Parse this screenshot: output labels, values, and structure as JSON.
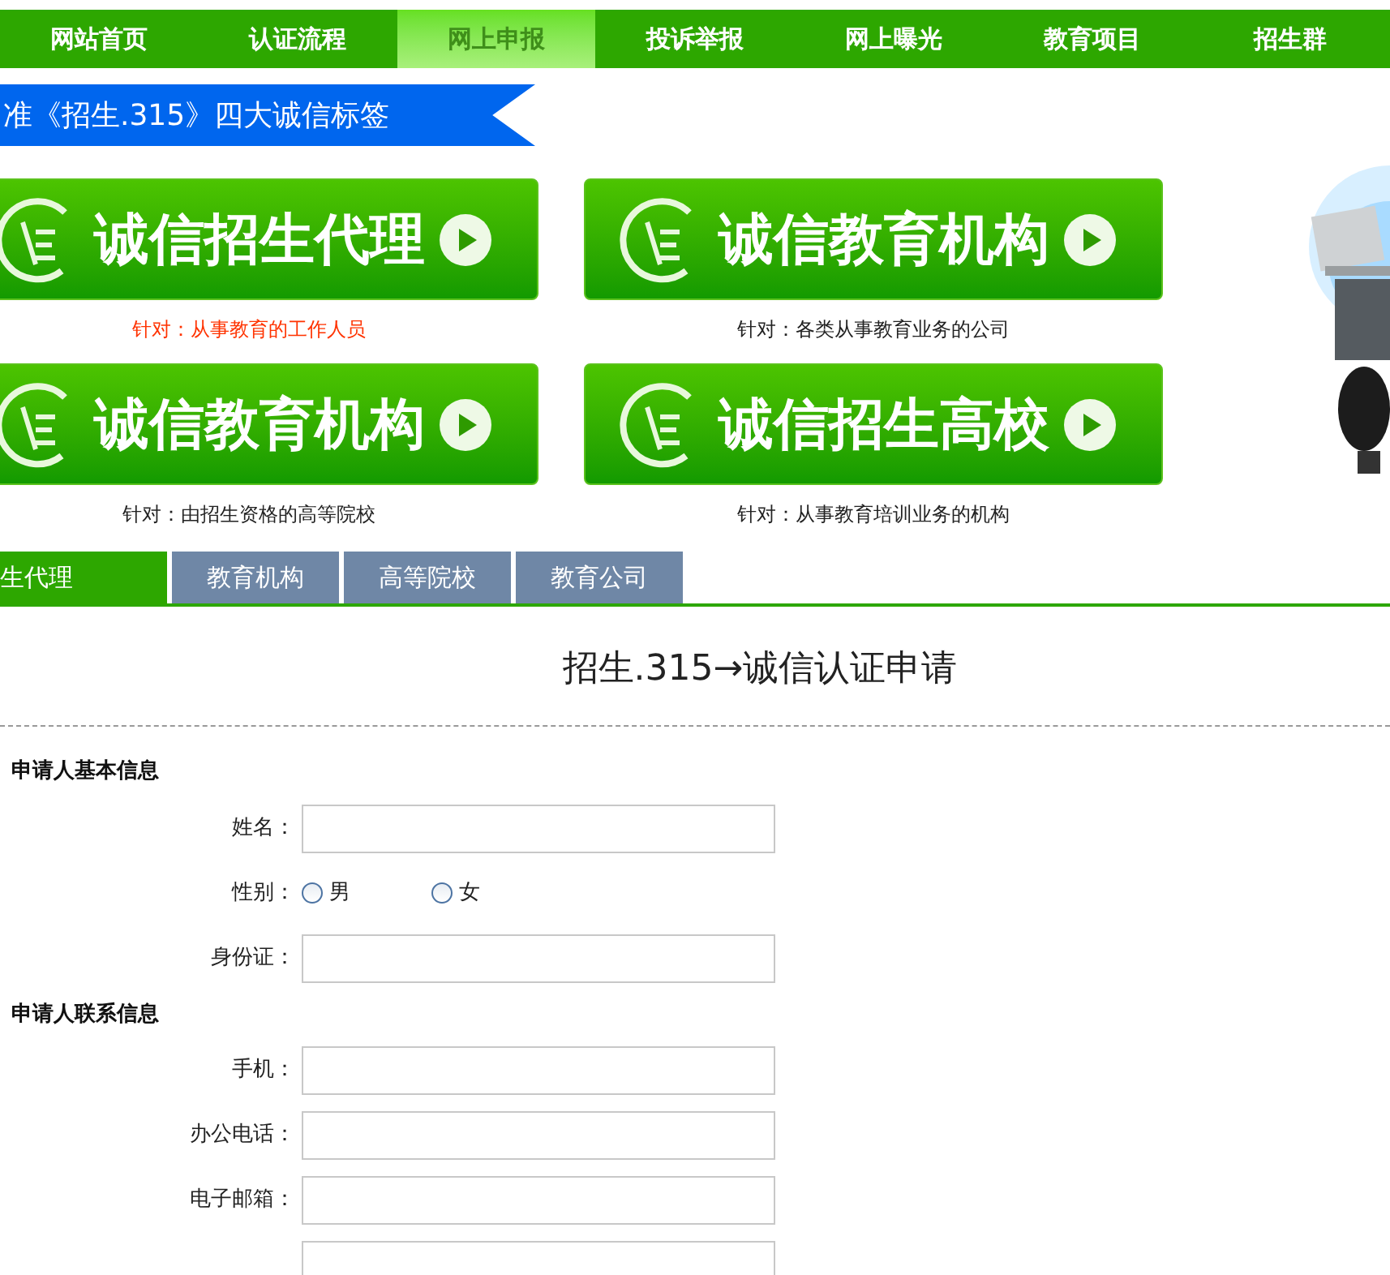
{
  "nav": [
    {
      "label": "网站首页",
      "selected": false
    },
    {
      "label": "认证流程",
      "selected": false
    },
    {
      "label": "网上申报",
      "selected": true
    },
    {
      "label": "投诉举报",
      "selected": false
    },
    {
      "label": "网上曝光",
      "selected": false
    },
    {
      "label": "教育项目",
      "selected": false
    },
    {
      "label": "招生群",
      "selected": false
    }
  ],
  "banner": "准《招生.315》四大诚信标签",
  "categories": [
    {
      "title": "诚信招生代理",
      "caption": "针对：从事教育的工作人员",
      "highlighted": true
    },
    {
      "title": "诚信教育机构",
      "caption": "针对：各类从事教育业务的公司",
      "highlighted": false
    },
    {
      "title": "诚信教育机构",
      "caption": "针对：由招生资格的高等院校",
      "highlighted": false
    },
    {
      "title": "诚信招生高校",
      "caption": "针对：从事教育培训业务的机构",
      "highlighted": false
    }
  ],
  "tabs": [
    {
      "label": "生代理",
      "selected": true
    },
    {
      "label": "教育机构",
      "selected": false
    },
    {
      "label": "高等院校",
      "selected": false
    },
    {
      "label": "教育公司",
      "selected": false
    }
  ],
  "form": {
    "title": "招生.315→诚信认证申请",
    "sections": [
      {
        "heading": "申请人基本信息",
        "fields": [
          {
            "kind": "text",
            "label": "姓名："
          },
          {
            "kind": "radio",
            "label": "性别：",
            "options": [
              {
                "label": "男",
                "selected": false
              },
              {
                "label": "女",
                "selected": false
              }
            ]
          },
          {
            "kind": "text",
            "label": "身份证："
          }
        ]
      },
      {
        "heading": "申请人联系信息",
        "fields": [
          {
            "kind": "text",
            "label": "手机："
          },
          {
            "kind": "text",
            "label": "办公电话："
          },
          {
            "kind": "text",
            "label": "电子邮箱："
          },
          {
            "kind": "text"
          }
        ]
      }
    ]
  }
}
